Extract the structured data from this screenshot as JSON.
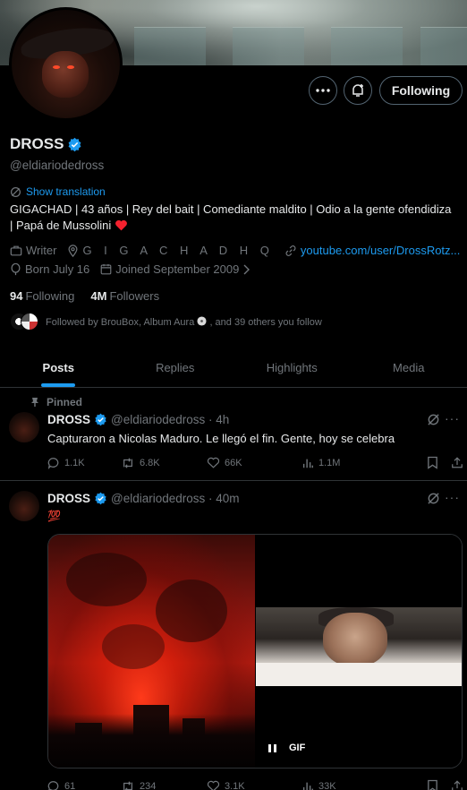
{
  "profile": {
    "name": "DROSS",
    "handle": "@eldiariodedross",
    "show_translation": "Show translation",
    "bio_line1": "GIGACHAD | 43 años | Rey del bait | Comediante maldito | Odio a la gente ofendidiza",
    "bio_line2": "| Papá de Mussolini",
    "category": "Writer",
    "location": "G I G A C H A D   H Q",
    "website": "youtube.com/user/DrossRotz...",
    "birthday": "Born July 16",
    "joined": "Joined September 2009",
    "following_count": "94",
    "following_label": "Following",
    "followers_count": "4M",
    "followers_label": "Followers",
    "followed_by": "Followed by BrouBox, Album Aura",
    "followed_by_rest": ", and 39 others you follow"
  },
  "actions": {
    "following_button": "Following"
  },
  "tabs": [
    "Posts",
    "Replies",
    "Highlights",
    "Media"
  ],
  "tweets": [
    {
      "pinned_label": "Pinned",
      "name": "DROSS",
      "handle_time": "@eldiariodedross · 4h",
      "text": "Capturaron a Nicolas Maduro. Le llegó el fin. Gente, hoy se celebra",
      "replies": "1.1K",
      "reposts": "6.8K",
      "likes": "66K",
      "views": "1.1M"
    },
    {
      "name": "DROSS",
      "handle_time": "@eldiariodedross · 40m",
      "text": "💯",
      "gif_label": "GIF",
      "replies": "61",
      "reposts": "234",
      "likes": "3.1K",
      "views": "33K"
    }
  ],
  "colors": {
    "accent": "#1d9bf0",
    "background": "#000000",
    "text": "#e7e9ea",
    "muted": "#71767b",
    "border": "#2f3336",
    "heart": "#f4212e"
  }
}
